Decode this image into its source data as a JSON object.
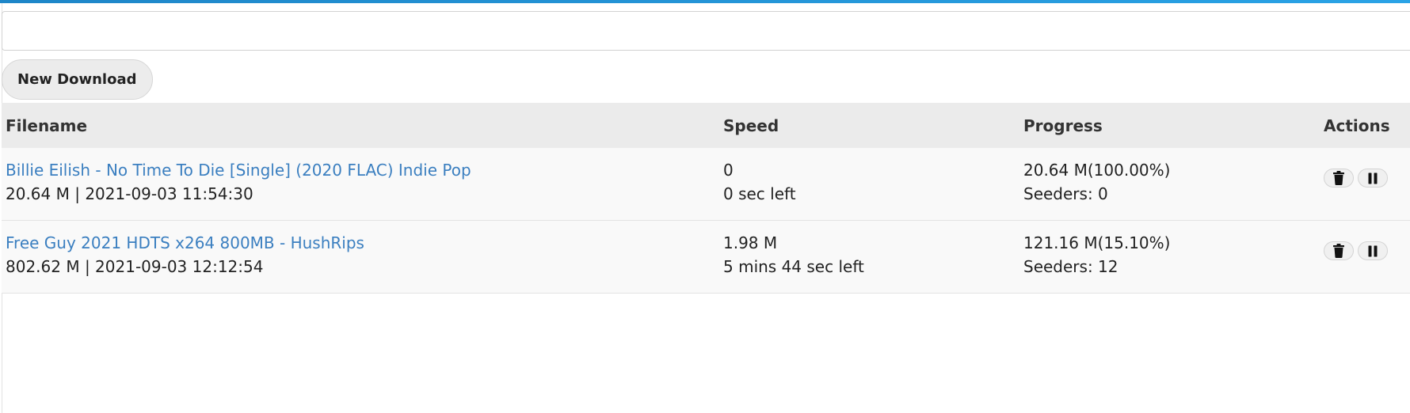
{
  "url_input": {
    "value": "",
    "placeholder": ""
  },
  "new_download_label": "New Download",
  "table": {
    "headers": {
      "filename": "Filename",
      "speed": "Speed",
      "progress": "Progress",
      "actions": "Actions"
    },
    "rows": [
      {
        "filename": "Billie Eilish - No Time To Die [Single] (2020 FLAC) Indie Pop",
        "meta": "20.64 M | 2021-09-03 11:54:30",
        "speed": "0",
        "time_left": "0 sec left",
        "progress": "20.64 M(100.00%)",
        "seeders": "Seeders: 0",
        "progress_fraction": 1.0,
        "actions": [
          "trash-icon",
          "pause-icon"
        ]
      },
      {
        "filename": "Free Guy 2021 HDTS x264 800MB - HushRips",
        "meta": "802.62 M | 2021-09-03 12:12:54",
        "speed": "1.98 M",
        "time_left": "5 mins 44 sec left",
        "progress": "121.16 M(15.10%)",
        "seeders": "Seeders: 12",
        "progress_fraction": 0.151,
        "actions": [
          "trash-icon",
          "pause-icon"
        ]
      }
    ]
  },
  "colors": {
    "accent_bar": "#1e86c8",
    "link": "#3b7fc0",
    "header_bg": "#ebebeb",
    "row_bg": "#f9f9f9"
  }
}
